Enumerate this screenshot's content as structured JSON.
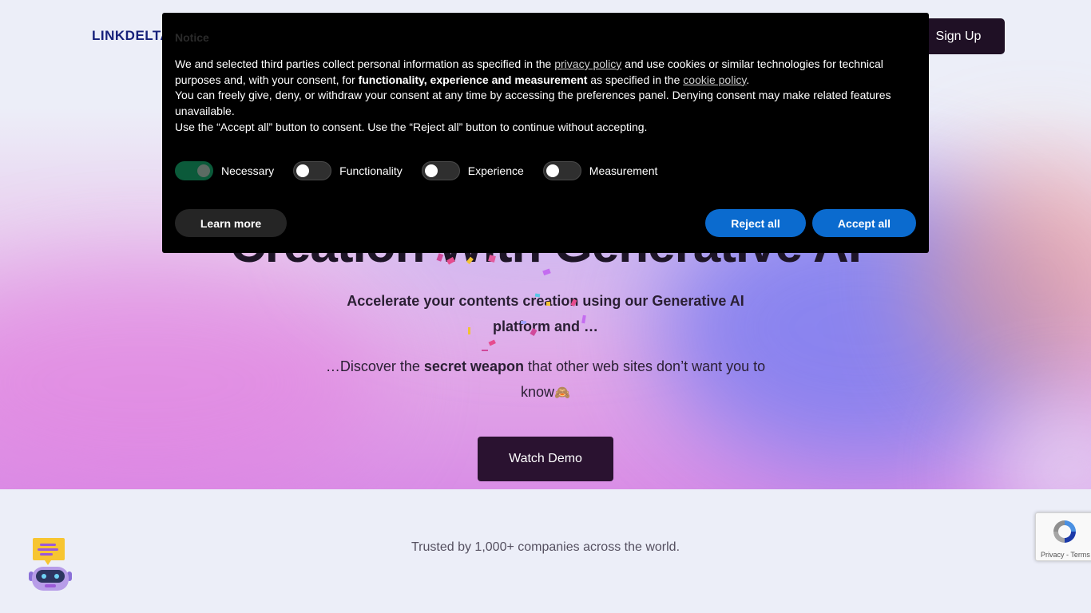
{
  "header": {
    "logo": "LINKDELTA",
    "signup_label": "Sign Up"
  },
  "hero": {
    "title_partial": "Creation With Generative AI",
    "subtitle": "Accelerate  your contents creation using our Generative AI platform and …",
    "discover_prefix": "…Discover the ",
    "discover_bold": "secret weapon",
    "discover_suffix": " that other web sites don’t want you to know",
    "discover_emoji": "🙈",
    "watch_demo_label": "Watch Demo"
  },
  "trusted_text": "Trusted by 1,000+ companies across the world.",
  "cookie_banner": {
    "title": "Notice",
    "p1_a": "We and selected third parties collect personal information as specified in the ",
    "privacy_link": "privacy policy",
    "p1_b": " and use cookies or similar technologies for technical purposes and, with your consent, for ",
    "p1_bold": "functionality, experience and measurement",
    "p1_c": " as specified in the ",
    "cookie_link": "cookie policy",
    "p1_d": ".",
    "p2": "You can freely give, deny, or withdraw your consent at any time by accessing the preferences panel. Denying consent may make related features unavailable.",
    "p3": "Use the “Accept all” button to consent. Use the “Reject all” button to continue without accepting.",
    "toggles": [
      {
        "label": "Necessary",
        "on": true
      },
      {
        "label": "Functionality",
        "on": false
      },
      {
        "label": "Experience",
        "on": false
      },
      {
        "label": "Measurement",
        "on": false
      }
    ],
    "learn_more_label": "Learn more",
    "reject_label": "Reject all",
    "accept_label": "Accept all"
  },
  "recaptcha": {
    "terms": "Privacy - Terms"
  },
  "icons": {
    "chatbot": "chatbot-robot-icon",
    "recaptcha": "recaptcha-logo-icon"
  },
  "colors": {
    "accent_button": "#0b6bcf",
    "dark_button": "#1f1025",
    "logo": "#16207a",
    "necessary_toggle": "#0b5a3a"
  }
}
